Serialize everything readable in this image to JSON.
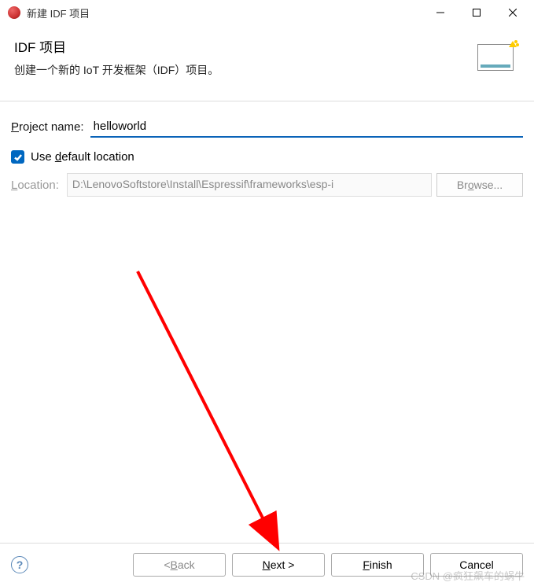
{
  "window": {
    "title": "新建 IDF 项目"
  },
  "header": {
    "title": "IDF 项目",
    "description": "创建一个新的 IoT 开发框架（IDF）项目。"
  },
  "form": {
    "projectNameLabel_pre": "P",
    "projectNameLabel_post": "roject name:",
    "projectNameValue": "helloworld",
    "useDefaultLabel_pre": "Use ",
    "useDefaultLabel_mn": "d",
    "useDefaultLabel_post": "efault location",
    "locationLabel_mn": "L",
    "locationLabel_post": "ocation:",
    "locationValue": "D:\\LenovoSoftstore\\Install\\Espressif\\frameworks\\esp-i",
    "browseLabel_pre": "Br",
    "browseLabel_mn": "o",
    "browseLabel_post": "wse..."
  },
  "footer": {
    "back_pre": "< ",
    "back_mn": "B",
    "back_post": "ack",
    "next_mn": "N",
    "next_post": "ext >",
    "finish_mn": "F",
    "finish_post": "inish",
    "cancel": "Cancel"
  },
  "watermark": "CSDN @疯狂飙车的蜗牛"
}
